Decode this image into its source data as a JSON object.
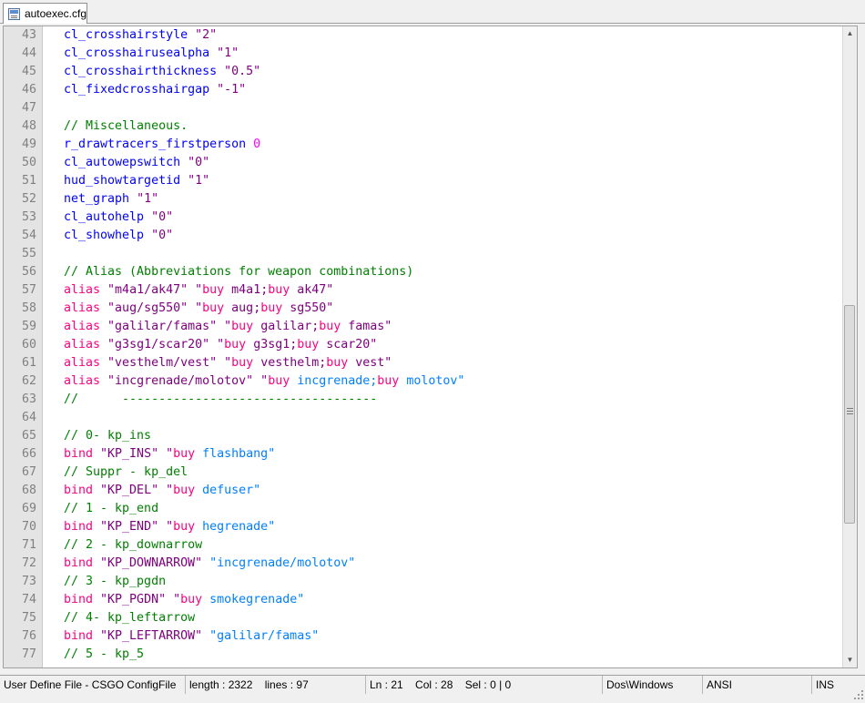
{
  "tab": {
    "filename": "autoexec.cfg",
    "icon": "file-icon"
  },
  "editor": {
    "lines": [
      {
        "n": "43",
        "tokens": [
          {
            "t": "cl_crosshairstyle ",
            "c": "kw"
          },
          {
            "t": "\"2\"",
            "c": "st"
          }
        ]
      },
      {
        "n": "44",
        "tokens": [
          {
            "t": "cl_crosshairusealpha ",
            "c": "kw"
          },
          {
            "t": "\"1\"",
            "c": "st"
          }
        ]
      },
      {
        "n": "45",
        "tokens": [
          {
            "t": "cl_crosshairthickness ",
            "c": "kw"
          },
          {
            "t": "\"0.5\"",
            "c": "st"
          }
        ]
      },
      {
        "n": "46",
        "tokens": [
          {
            "t": "cl_fixedcrosshairgap ",
            "c": "kw"
          },
          {
            "t": "\"-1\"",
            "c": "st"
          }
        ]
      },
      {
        "n": "47",
        "tokens": []
      },
      {
        "n": "48",
        "tokens": [
          {
            "t": "// Miscellaneous.",
            "c": "cm"
          }
        ]
      },
      {
        "n": "49",
        "tokens": [
          {
            "t": "r_drawtracers_firstperson ",
            "c": "kw"
          },
          {
            "t": "0",
            "c": "num"
          }
        ]
      },
      {
        "n": "50",
        "tokens": [
          {
            "t": "cl_autowepswitch ",
            "c": "kw"
          },
          {
            "t": "\"0\"",
            "c": "st"
          }
        ]
      },
      {
        "n": "51",
        "tokens": [
          {
            "t": "hud_showtargetid ",
            "c": "kw"
          },
          {
            "t": "\"1\"",
            "c": "st"
          }
        ]
      },
      {
        "n": "52",
        "tokens": [
          {
            "t": "net_graph ",
            "c": "kw"
          },
          {
            "t": "\"1\"",
            "c": "st"
          }
        ]
      },
      {
        "n": "53",
        "tokens": [
          {
            "t": "cl_autohelp ",
            "c": "kw"
          },
          {
            "t": "\"0\"",
            "c": "st"
          }
        ]
      },
      {
        "n": "54",
        "tokens": [
          {
            "t": "cl_showhelp ",
            "c": "kw"
          },
          {
            "t": "\"0\"",
            "c": "st"
          }
        ]
      },
      {
        "n": "55",
        "tokens": []
      },
      {
        "n": "56",
        "tokens": [
          {
            "t": "// Alias (Abbreviations for weapon combinations)",
            "c": "cm"
          }
        ]
      },
      {
        "n": "57",
        "tokens": [
          {
            "t": "alias ",
            "c": "pk"
          },
          {
            "t": "\"m4a1/ak47\" ",
            "c": "st"
          },
          {
            "t": "\"",
            "c": "st"
          },
          {
            "t": "buy ",
            "c": "pk"
          },
          {
            "t": "m4a1;",
            "c": "st"
          },
          {
            "t": "buy ",
            "c": "pk"
          },
          {
            "t": "ak47\"",
            "c": "st"
          }
        ]
      },
      {
        "n": "58",
        "tokens": [
          {
            "t": "alias ",
            "c": "pk"
          },
          {
            "t": "\"aug/sg550\" ",
            "c": "st"
          },
          {
            "t": "\"",
            "c": "st"
          },
          {
            "t": "buy ",
            "c": "pk"
          },
          {
            "t": "aug;",
            "c": "st"
          },
          {
            "t": "buy ",
            "c": "pk"
          },
          {
            "t": "sg550\"",
            "c": "st"
          }
        ]
      },
      {
        "n": "59",
        "tokens": [
          {
            "t": "alias ",
            "c": "pk"
          },
          {
            "t": "\"galilar/famas\" ",
            "c": "st"
          },
          {
            "t": "\"",
            "c": "st"
          },
          {
            "t": "buy ",
            "c": "pk"
          },
          {
            "t": "galilar;",
            "c": "st"
          },
          {
            "t": "buy ",
            "c": "pk"
          },
          {
            "t": "famas\"",
            "c": "st"
          }
        ]
      },
      {
        "n": "60",
        "tokens": [
          {
            "t": "alias ",
            "c": "pk"
          },
          {
            "t": "\"g3sg1/scar20\" ",
            "c": "st"
          },
          {
            "t": "\"",
            "c": "st"
          },
          {
            "t": "buy ",
            "c": "pk"
          },
          {
            "t": "g3sg1;",
            "c": "st"
          },
          {
            "t": "buy ",
            "c": "pk"
          },
          {
            "t": "scar20\"",
            "c": "st"
          }
        ]
      },
      {
        "n": "61",
        "tokens": [
          {
            "t": "alias ",
            "c": "pk"
          },
          {
            "t": "\"vesthelm/vest\" ",
            "c": "st"
          },
          {
            "t": "\"",
            "c": "st"
          },
          {
            "t": "buy ",
            "c": "pk"
          },
          {
            "t": "vesthelm;",
            "c": "st"
          },
          {
            "t": "buy ",
            "c": "pk"
          },
          {
            "t": "vest\"",
            "c": "st"
          }
        ]
      },
      {
        "n": "62",
        "tokens": [
          {
            "t": "alias ",
            "c": "pk"
          },
          {
            "t": "\"incgrenade/molotov\" ",
            "c": "st"
          },
          {
            "t": "\"",
            "c": "st"
          },
          {
            "t": "buy ",
            "c": "pk"
          },
          {
            "t": "incgrenade;",
            "c": "sb"
          },
          {
            "t": "buy ",
            "c": "pk"
          },
          {
            "t": "molotov\"",
            "c": "sb"
          }
        ]
      },
      {
        "n": "63",
        "tokens": [
          {
            "t": "//      -----------------------------------",
            "c": "cm"
          }
        ]
      },
      {
        "n": "64",
        "tokens": []
      },
      {
        "n": "65",
        "tokens": [
          {
            "t": "// 0- kp_ins",
            "c": "cm"
          }
        ]
      },
      {
        "n": "66",
        "tokens": [
          {
            "t": "bind ",
            "c": "pk"
          },
          {
            "t": "\"KP_INS\" ",
            "c": "st"
          },
          {
            "t": "\"",
            "c": "st"
          },
          {
            "t": "buy ",
            "c": "pk"
          },
          {
            "t": "flashbang\"",
            "c": "sb"
          }
        ]
      },
      {
        "n": "67",
        "tokens": [
          {
            "t": "// Suppr - kp_del",
            "c": "cm"
          }
        ]
      },
      {
        "n": "68",
        "tokens": [
          {
            "t": "bind ",
            "c": "pk"
          },
          {
            "t": "\"KP_DEL\" ",
            "c": "st"
          },
          {
            "t": "\"",
            "c": "st"
          },
          {
            "t": "buy ",
            "c": "pk"
          },
          {
            "t": "defuser\"",
            "c": "sb"
          }
        ]
      },
      {
        "n": "69",
        "tokens": [
          {
            "t": "// 1 - kp_end",
            "c": "cm"
          }
        ]
      },
      {
        "n": "70",
        "tokens": [
          {
            "t": "bind ",
            "c": "pk"
          },
          {
            "t": "\"KP_END\" ",
            "c": "st"
          },
          {
            "t": "\"",
            "c": "st"
          },
          {
            "t": "buy ",
            "c": "pk"
          },
          {
            "t": "hegrenade\"",
            "c": "sb"
          }
        ]
      },
      {
        "n": "71",
        "tokens": [
          {
            "t": "// 2 - kp_downarrow",
            "c": "cm"
          }
        ]
      },
      {
        "n": "72",
        "tokens": [
          {
            "t": "bind ",
            "c": "pk"
          },
          {
            "t": "\"KP_DOWNARROW\" ",
            "c": "st"
          },
          {
            "t": "\"incgrenade/molotov\"",
            "c": "sb"
          }
        ]
      },
      {
        "n": "73",
        "tokens": [
          {
            "t": "// 3 - kp_pgdn",
            "c": "cm"
          }
        ]
      },
      {
        "n": "74",
        "tokens": [
          {
            "t": "bind ",
            "c": "pk"
          },
          {
            "t": "\"KP_PGDN\" ",
            "c": "st"
          },
          {
            "t": "\"",
            "c": "st"
          },
          {
            "t": "buy ",
            "c": "pk"
          },
          {
            "t": "smokegrenade\"",
            "c": "sb"
          }
        ]
      },
      {
        "n": "75",
        "tokens": [
          {
            "t": "// 4- kp_leftarrow",
            "c": "cm"
          }
        ]
      },
      {
        "n": "76",
        "tokens": [
          {
            "t": "bind ",
            "c": "pk"
          },
          {
            "t": "\"KP_LEFTARROW\" ",
            "c": "st"
          },
          {
            "t": "\"galilar/famas\"",
            "c": "sb"
          }
        ]
      },
      {
        "n": "77",
        "tokens": [
          {
            "t": "// 5 - kp_5",
            "c": "cm"
          }
        ]
      }
    ]
  },
  "statusbar": {
    "language": "User Define File - CSGO ConfigFile",
    "length_lines": "length : 2322    lines : 97",
    "position": "Ln : 21    Col : 28    Sel : 0 | 0",
    "eol": "Dos\\Windows",
    "encoding": "ANSI",
    "mode": "INS"
  }
}
